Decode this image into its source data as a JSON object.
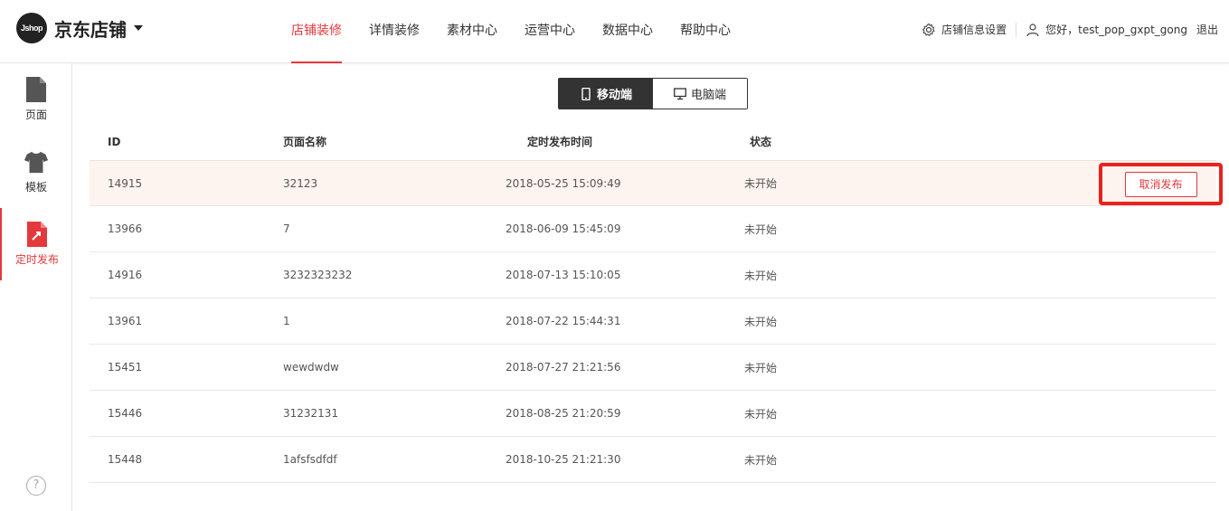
{
  "header": {
    "logo_badge": "Jshop",
    "logo_text": "京东店铺",
    "nav": [
      "店铺装修",
      "详情装修",
      "素材中心",
      "运营中心",
      "数据中心",
      "帮助中心"
    ],
    "active_nav": "店铺装修",
    "settings_label": "店铺信息设置",
    "greeting": "您好，test_pop_gxpt_gong",
    "logout_label": "退出"
  },
  "sidebar": {
    "items": [
      {
        "label": "页面",
        "icon": "page-icon"
      },
      {
        "label": "模板",
        "icon": "tshirt-icon"
      },
      {
        "label": "定时发布",
        "icon": "scheduled-publish-icon"
      }
    ],
    "active_item": "定时发布",
    "help_glyph": "?"
  },
  "toggle": {
    "mobile_label": "移动端",
    "pc_label": "电脑端",
    "active": "移动端"
  },
  "table": {
    "headers": {
      "id": "ID",
      "name": "页面名称",
      "time": "定时发布时间",
      "status": "状态"
    },
    "rows": [
      {
        "id": "14915",
        "name": "32123",
        "time": "2018-05-25 15:09:49",
        "status": "未开始",
        "action": "取消发布"
      },
      {
        "id": "13966",
        "name": "7",
        "time": "2018-06-09 15:45:09",
        "status": "未开始"
      },
      {
        "id": "14916",
        "name": "3232323232",
        "time": "2018-07-13 15:10:05",
        "status": "未开始"
      },
      {
        "id": "13961",
        "name": "1",
        "time": "2018-07-22 15:44:31",
        "status": "未开始"
      },
      {
        "id": "15451",
        "name": "wewdwdw",
        "time": "2018-07-27 21:21:56",
        "status": "未开始"
      },
      {
        "id": "15446",
        "name": "31232131",
        "time": "2018-08-25 21:20:59",
        "status": "未开始"
      },
      {
        "id": "15448",
        "name": "1afsfsdfdf",
        "time": "2018-10-25 21:21:30",
        "status": "未开始"
      }
    ]
  },
  "colors": {
    "accent": "#e4393c",
    "dark": "#333333",
    "highlight_row": "#fdf3ef",
    "annotation_box": "#e8231c"
  }
}
